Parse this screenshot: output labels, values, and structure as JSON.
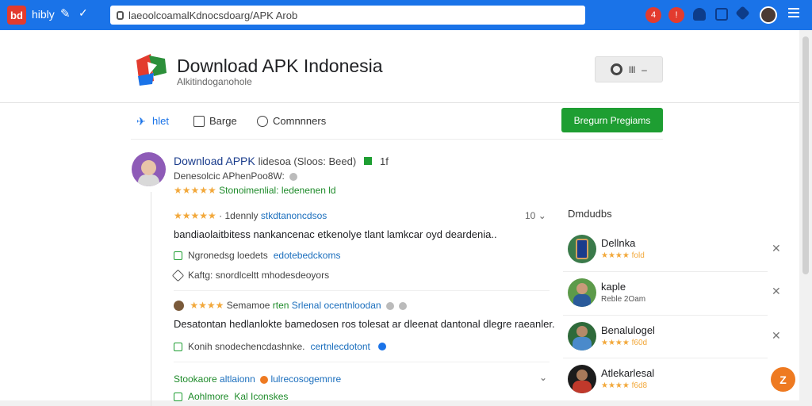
{
  "browser": {
    "app_logo": "bd",
    "brand": "hibly",
    "url": "laeoolcoamalKdnocsdoarg/APK Arob",
    "colors": {
      "bar": "#1a73e8",
      "logo": "#e33b2e"
    }
  },
  "header": {
    "title": "Download APK Indonesia",
    "subtitle": "Alkitindoganohole",
    "settings_label": "lll"
  },
  "tabs": [
    {
      "label": "hlet",
      "icon": "home-icon"
    },
    {
      "label": "Barge",
      "icon": "book-icon"
    },
    {
      "label": "Comnnners",
      "icon": "comment-icon"
    }
  ],
  "primary_button": "Bregurn Pregiams",
  "app": {
    "name": "Download APPK",
    "name_meta": "lidesoa (Sloos: Beed)",
    "count": "1f",
    "developer": "Denesolcic APhenPoo8W:",
    "stars": "★★★★★",
    "rating_text": "Stonoimenlial: ledenenen ld"
  },
  "reviews": [
    {
      "stars": "★★★★★",
      "author": "1dennly",
      "tag": "stkdtanoncdsos",
      "count": "10",
      "text": "bandiaolaitbitess nankancenac etkenolye tlant lamkcar oyd deardenia..",
      "actions": [
        {
          "label": "Ngronedsg loedets",
          "link": "edotebedckoms"
        },
        {
          "label": "Kaftg: snordlceltt mhodesdeoyors",
          "link": ""
        }
      ]
    },
    {
      "stars": "★★★★",
      "author": "Semamoe",
      "tag": "rten",
      "tag2": "Srlenal ocentnloodan",
      "text": "Desatontan hedlanlokte bamedosen ros tolesat ar dleenat dantonal dlegre raeanler.",
      "actions": [
        {
          "label": "Konih snodechencdashnke.",
          "link": "certnlecdotont"
        }
      ]
    },
    {
      "author": "Stookaore",
      "tag": "altlaionn",
      "tag2": "lulrecosogemnre",
      "sub_label": "Aohlmore",
      "sub_link": "Kal Iconskes"
    }
  ],
  "related": {
    "title": "Dmdudbs",
    "items": [
      {
        "name": "Dellnka",
        "meta": "★★★★ fold",
        "thumb": "phone-thumb"
      },
      {
        "name": "kaple",
        "meta": "Reble 2Oam",
        "thumb": "person-thumb"
      },
      {
        "name": "Benalulogel",
        "meta": "★★★★ f60d",
        "thumb": "person-thumb"
      },
      {
        "name": "Atlekarlesal",
        "meta": "★★★★ f6d8",
        "thumb": "person-thumb"
      }
    ]
  },
  "fab_label": "Z"
}
